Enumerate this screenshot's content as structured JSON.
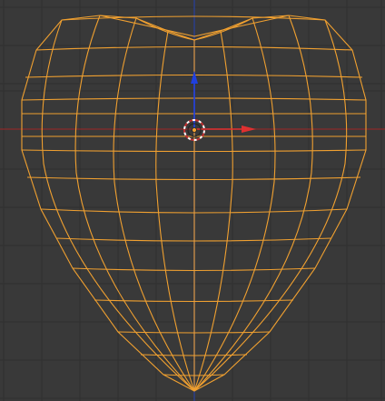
{
  "viewport": {
    "background": "#393939",
    "grid_color": "#2f2f2f",
    "x_axis_color": "#8a2a2a",
    "y_axis_color": "#2a3f8f"
  },
  "mesh": {
    "wire_color": "#f0a030",
    "selected": true
  },
  "gizmo": {
    "x_arrow_color": "#e03030",
    "z_arrow_color": "#2040e0",
    "icons": [
      "3d-cursor-icon",
      "object-origin-icon"
    ]
  }
}
